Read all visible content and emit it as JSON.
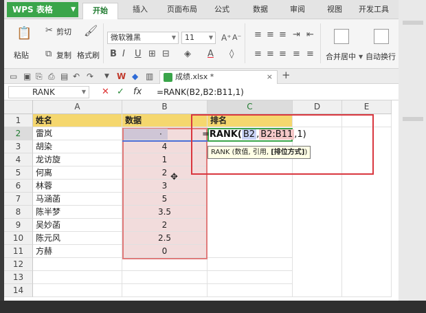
{
  "menubar": {
    "app_name": "WPS 表格",
    "tabs": [
      "开始",
      "插入",
      "页面布局",
      "公式",
      "数据",
      "审阅",
      "视图",
      "开发工具"
    ],
    "active_tab": "开始"
  },
  "ribbon": {
    "cut": "剪切",
    "paste": "粘贴",
    "copy": "复制",
    "format_painter": "格式刷",
    "font_name": "微软雅黑",
    "font_size": "11",
    "bold": "B",
    "italic": "I",
    "underline": "U",
    "merge_center": "合并居中",
    "auto_wrap": "自动换行"
  },
  "doc_tab": {
    "file_name": "成绩.xlsx *"
  },
  "formula_bar": {
    "name_box": "RANK",
    "fx": "fx",
    "formula": "=RANK(B2,B2:B11,1)"
  },
  "sheet": {
    "columns": [
      "A",
      "B",
      "C",
      "D",
      "E"
    ],
    "rows": [
      "1",
      "2",
      "3",
      "4",
      "5",
      "6",
      "7",
      "8",
      "9",
      "10",
      "11",
      "12",
      "13",
      "14"
    ],
    "headers": {
      "name": "姓名",
      "data": "数据",
      "rank": "排名"
    },
    "names": [
      "雷岚",
      "胡染",
      "龙访旋",
      "何离",
      "林蓉",
      "马涵菡",
      "陈半梦",
      "吴妙菡",
      "陈元风",
      "方赫"
    ],
    "values": [
      "",
      "4",
      "1",
      "2",
      "3",
      "5",
      "3.5",
      "2",
      "2.5",
      "0"
    ],
    "b2_partial": "·"
  },
  "editing": {
    "prefix": "=",
    "fn": "RANK(",
    "ref1": "B2",
    "sep1": ",",
    "ref2": "B2:B11",
    "sep2": ",",
    "arg3": "1",
    "close": ")",
    "tooltip_prefix": "RANK (数值, 引用,",
    "tooltip_bold": "[排位方式]",
    "tooltip_suffix": ")"
  },
  "colors": {
    "brand_green": "#3aa54a",
    "header_yellow": "#f5d76e",
    "data_pink": "#f2dcdc",
    "highlight_red": "#d9363e"
  }
}
